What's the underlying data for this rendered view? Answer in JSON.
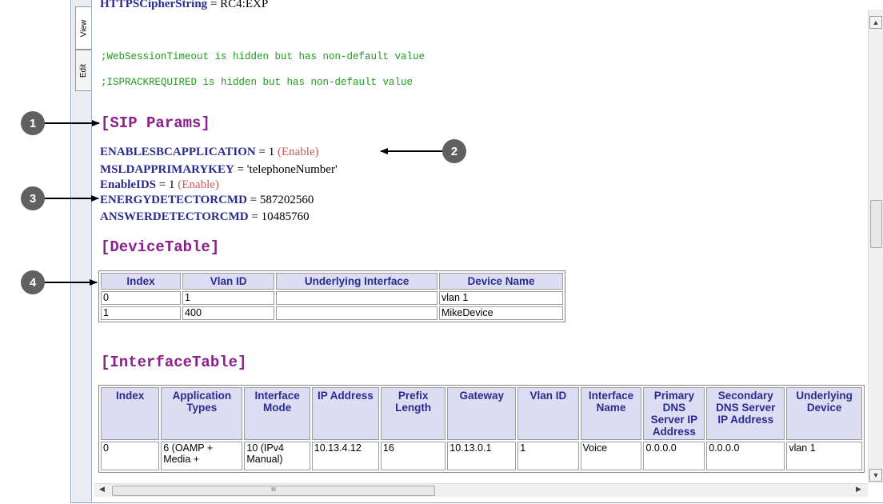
{
  "tabs": {
    "view": "View",
    "edit": "Edit"
  },
  "top_param": {
    "name": "HTTPSCipherString",
    "eq": " = ",
    "value": "RC4:EXP"
  },
  "comments": [
    ";WebSessionTimeout is hidden but has non-default value",
    ";ISPRACKREQUIRED is hidden but has non-default value"
  ],
  "sections": {
    "sip": "[SIP Params]",
    "device": "[DeviceTable]",
    "interface": "[InterfaceTable]"
  },
  "sip_params": [
    {
      "name": "ENABLESBCAPPLICATION",
      "eq": " = ",
      "value": "1",
      "enum": " (Enable)"
    },
    {
      "name": "MSLDAPPRIMARYKEY",
      "eq": " = ",
      "value": "'telephoneNumber'",
      "enum": ""
    },
    {
      "name": "EnableIDS",
      "eq": " = ",
      "value": "1",
      "enum": " (Enable)"
    },
    {
      "name": "ENERGYDETECTORCMD",
      "eq": " = ",
      "value": "587202560",
      "enum": ""
    },
    {
      "name": "ANSWERDETECTORCMD",
      "eq": " = ",
      "value": "10485760",
      "enum": ""
    }
  ],
  "device_table": {
    "headers": [
      "Index",
      "Vlan ID",
      "Underlying Interface",
      "Device Name"
    ],
    "rows": [
      [
        "0",
        "1",
        "",
        "vlan 1"
      ],
      [
        "1",
        "400",
        "",
        "MikeDevice"
      ]
    ]
  },
  "interface_table": {
    "headers": [
      "Index",
      "Application Types",
      "Interface Mode",
      "IP Address",
      "Prefix Length",
      "Gateway",
      "Vlan ID",
      "Interface Name",
      "Primary DNS Server IP Address",
      "Secondary DNS Server IP Address",
      "Underlying Device"
    ],
    "rows": [
      [
        "0",
        "6 (OAMP + Media +",
        "10 (IPv4 Manual)",
        "10.13.4.12",
        "16",
        "10.13.0.1",
        "1",
        "Voice",
        "0.0.0.0",
        "0.0.0.0",
        "vlan 1"
      ]
    ]
  },
  "callouts": [
    "1",
    "2",
    "3",
    "4"
  ],
  "scrollbar": {
    "grip": "III"
  },
  "colors": {
    "param_name": "#2b2b8f",
    "section": "#8b1f8b",
    "comment": "#1e9a1e",
    "enum": "#c45a5a",
    "header_bg": "#dcdcf2",
    "callout": "#5f6062"
  }
}
